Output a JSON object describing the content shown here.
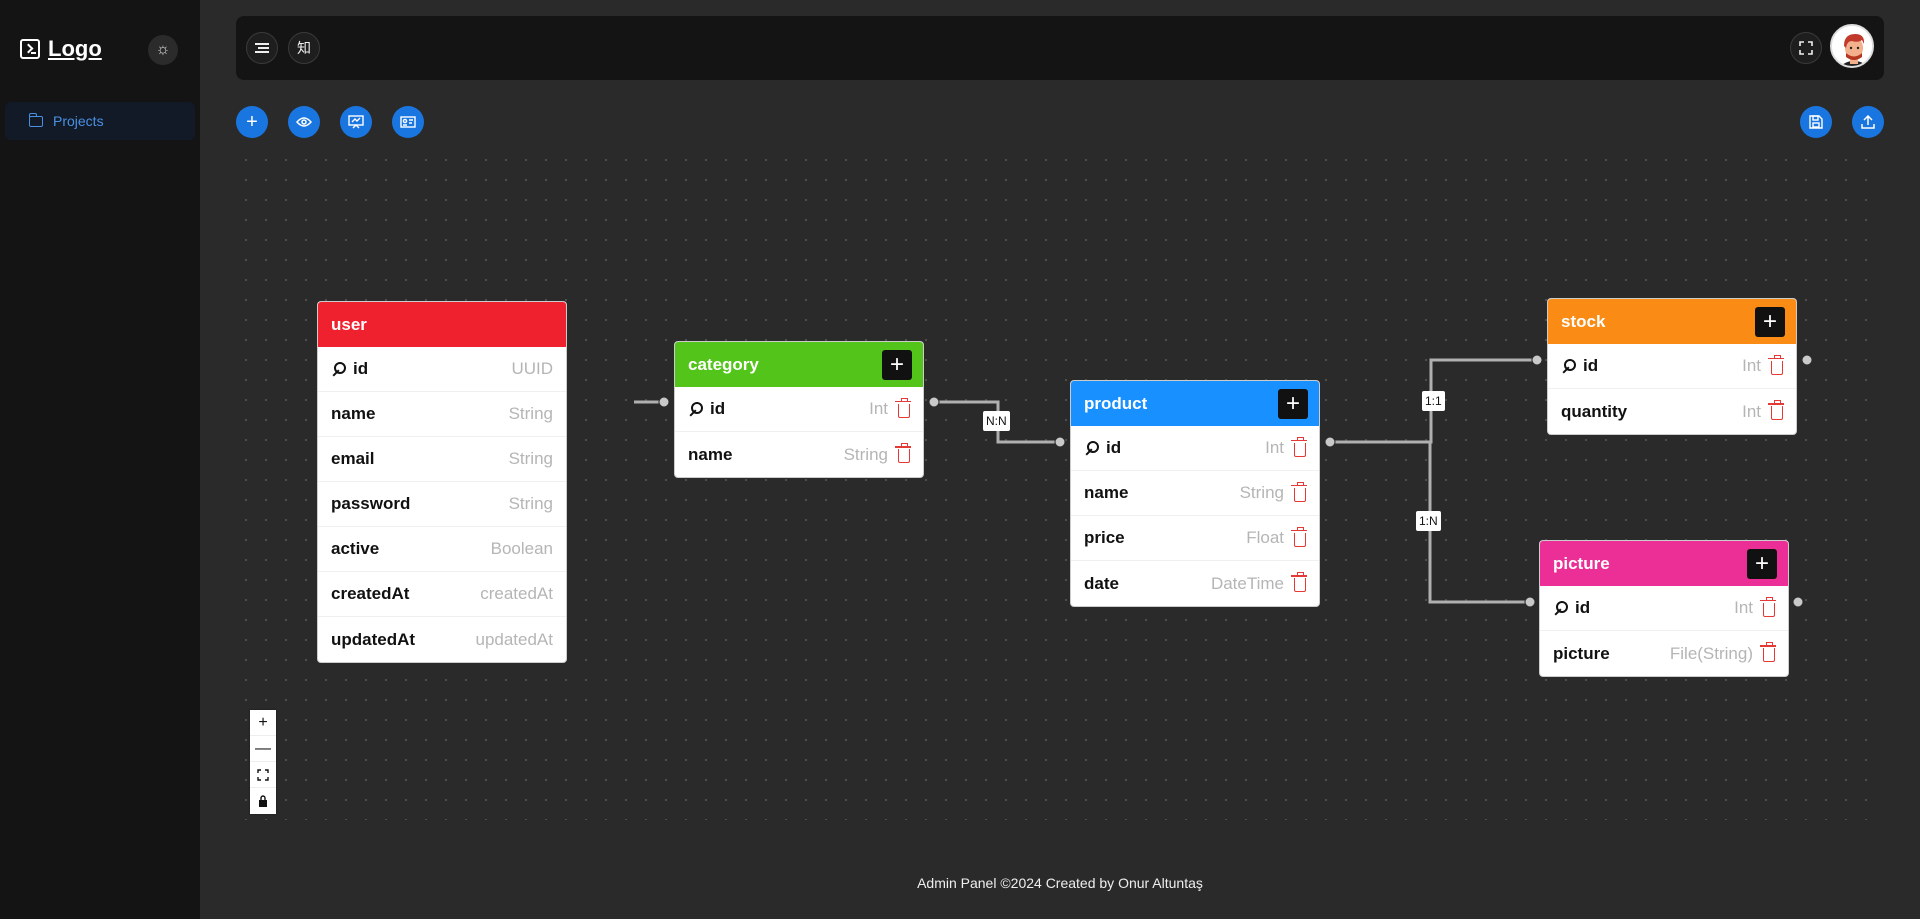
{
  "sidebar": {
    "logo_text": "Logo",
    "items": [
      {
        "label": "Projects",
        "icon": "folder-icon"
      }
    ]
  },
  "header": {
    "lang_label": "知"
  },
  "toolbar": {
    "left_buttons": [
      "plus-icon",
      "eye-icon",
      "presentation-icon",
      "id-card-icon"
    ],
    "right_buttons": [
      "save-icon",
      "upload-icon"
    ]
  },
  "tables": {
    "user": {
      "title": "user",
      "color": "#f0212e",
      "fields": [
        {
          "name": "id",
          "type": "UUID",
          "pk": true
        },
        {
          "name": "name",
          "type": "String"
        },
        {
          "name": "email",
          "type": "String"
        },
        {
          "name": "password",
          "type": "String"
        },
        {
          "name": "active",
          "type": "Boolean"
        },
        {
          "name": "createdAt",
          "type": "createdAt"
        },
        {
          "name": "updatedAt",
          "type": "updatedAt"
        }
      ]
    },
    "category": {
      "title": "category",
      "color": "#52c41a",
      "fields": [
        {
          "name": "id",
          "type": "Int",
          "pk": true
        },
        {
          "name": "name",
          "type": "String"
        }
      ]
    },
    "product": {
      "title": "product",
      "color": "#1890ff",
      "fields": [
        {
          "name": "id",
          "type": "Int",
          "pk": true
        },
        {
          "name": "name",
          "type": "String"
        },
        {
          "name": "price",
          "type": "Float"
        },
        {
          "name": "date",
          "type": "DateTime"
        }
      ]
    },
    "stock": {
      "title": "stock",
      "color": "#fa8c16",
      "fields": [
        {
          "name": "id",
          "type": "Int",
          "pk": true
        },
        {
          "name": "quantity",
          "type": "Int"
        }
      ]
    },
    "picture": {
      "title": "picture",
      "color": "#eb2f96",
      "fields": [
        {
          "name": "id",
          "type": "Int",
          "pk": true
        },
        {
          "name": "picture",
          "type": "File(String)"
        }
      ]
    }
  },
  "relations": [
    {
      "label": "N:N",
      "from": "category",
      "to": "product"
    },
    {
      "label": "1:1",
      "from": "product",
      "to": "stock"
    },
    {
      "label": "1:N",
      "from": "product",
      "to": "picture"
    }
  ],
  "zoom_controls": [
    "+",
    "—",
    "fit",
    "lock"
  ],
  "footer": {
    "text": "Admin Panel ©2024 Created by Onur Altuntaş"
  }
}
